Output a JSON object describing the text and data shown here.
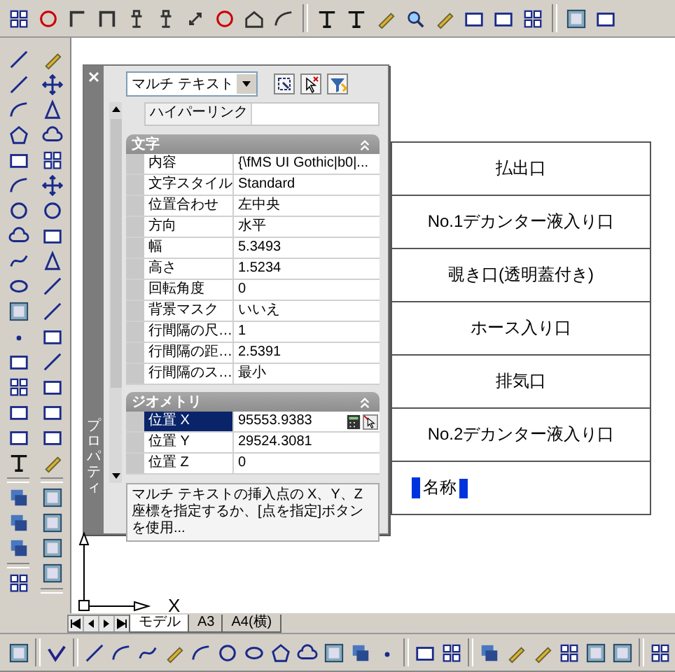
{
  "palette": {
    "title": "プロパティ",
    "object_type": "マルチ テキスト",
    "hyperlink": {
      "label": "ハイパーリンク"
    },
    "sections": [
      {
        "title": "文字",
        "expanded": true,
        "rows": [
          {
            "label": "内容",
            "value": "{\\fMS UI Gothic|b0|...",
            "selected": false
          },
          {
            "label": "文字スタイル",
            "value": "Standard",
            "selected": false
          },
          {
            "label": "位置合わせ",
            "value": "左中央",
            "selected": false
          },
          {
            "label": "方向",
            "value": "水平",
            "selected": false
          },
          {
            "label": "幅",
            "value": "5.3493",
            "selected": false
          },
          {
            "label": "高さ",
            "value": "1.5234",
            "selected": false
          },
          {
            "label": "回転角度",
            "value": "0",
            "selected": false
          },
          {
            "label": "背景マスク",
            "value": "いいえ",
            "selected": false
          },
          {
            "label": "行間隔の尺…",
            "value": "1",
            "selected": false
          },
          {
            "label": "行間隔の距…",
            "value": "2.5391",
            "selected": false
          },
          {
            "label": "行間隔のス…",
            "value": "最小",
            "selected": false
          }
        ]
      },
      {
        "title": "ジオメトリ",
        "expanded": true,
        "rows": [
          {
            "label": "位置 X",
            "value": "95553.9383",
            "selected": true
          },
          {
            "label": "位置 Y",
            "value": "29524.3081",
            "selected": false
          },
          {
            "label": "位置 Z",
            "value": "0",
            "selected": false
          }
        ]
      }
    ],
    "description": "マルチ テキストの挿入点の X、Y、Z 座標を指定するか、[点を指定]ボタンを使用..."
  },
  "drawing": {
    "table_rows": [
      "払出口",
      "No.1デカンター液入り口",
      "覗き口(透明蓋付き)",
      "ホース入り口",
      "排気口",
      "No.2デカンター液入り口"
    ],
    "editing_text": "名称",
    "axis_label": "X"
  },
  "layout_tabs": [
    {
      "label": "モデル",
      "selected": true
    },
    {
      "label": "A3",
      "selected": false
    },
    {
      "label": "A4(横)",
      "selected": false
    }
  ]
}
